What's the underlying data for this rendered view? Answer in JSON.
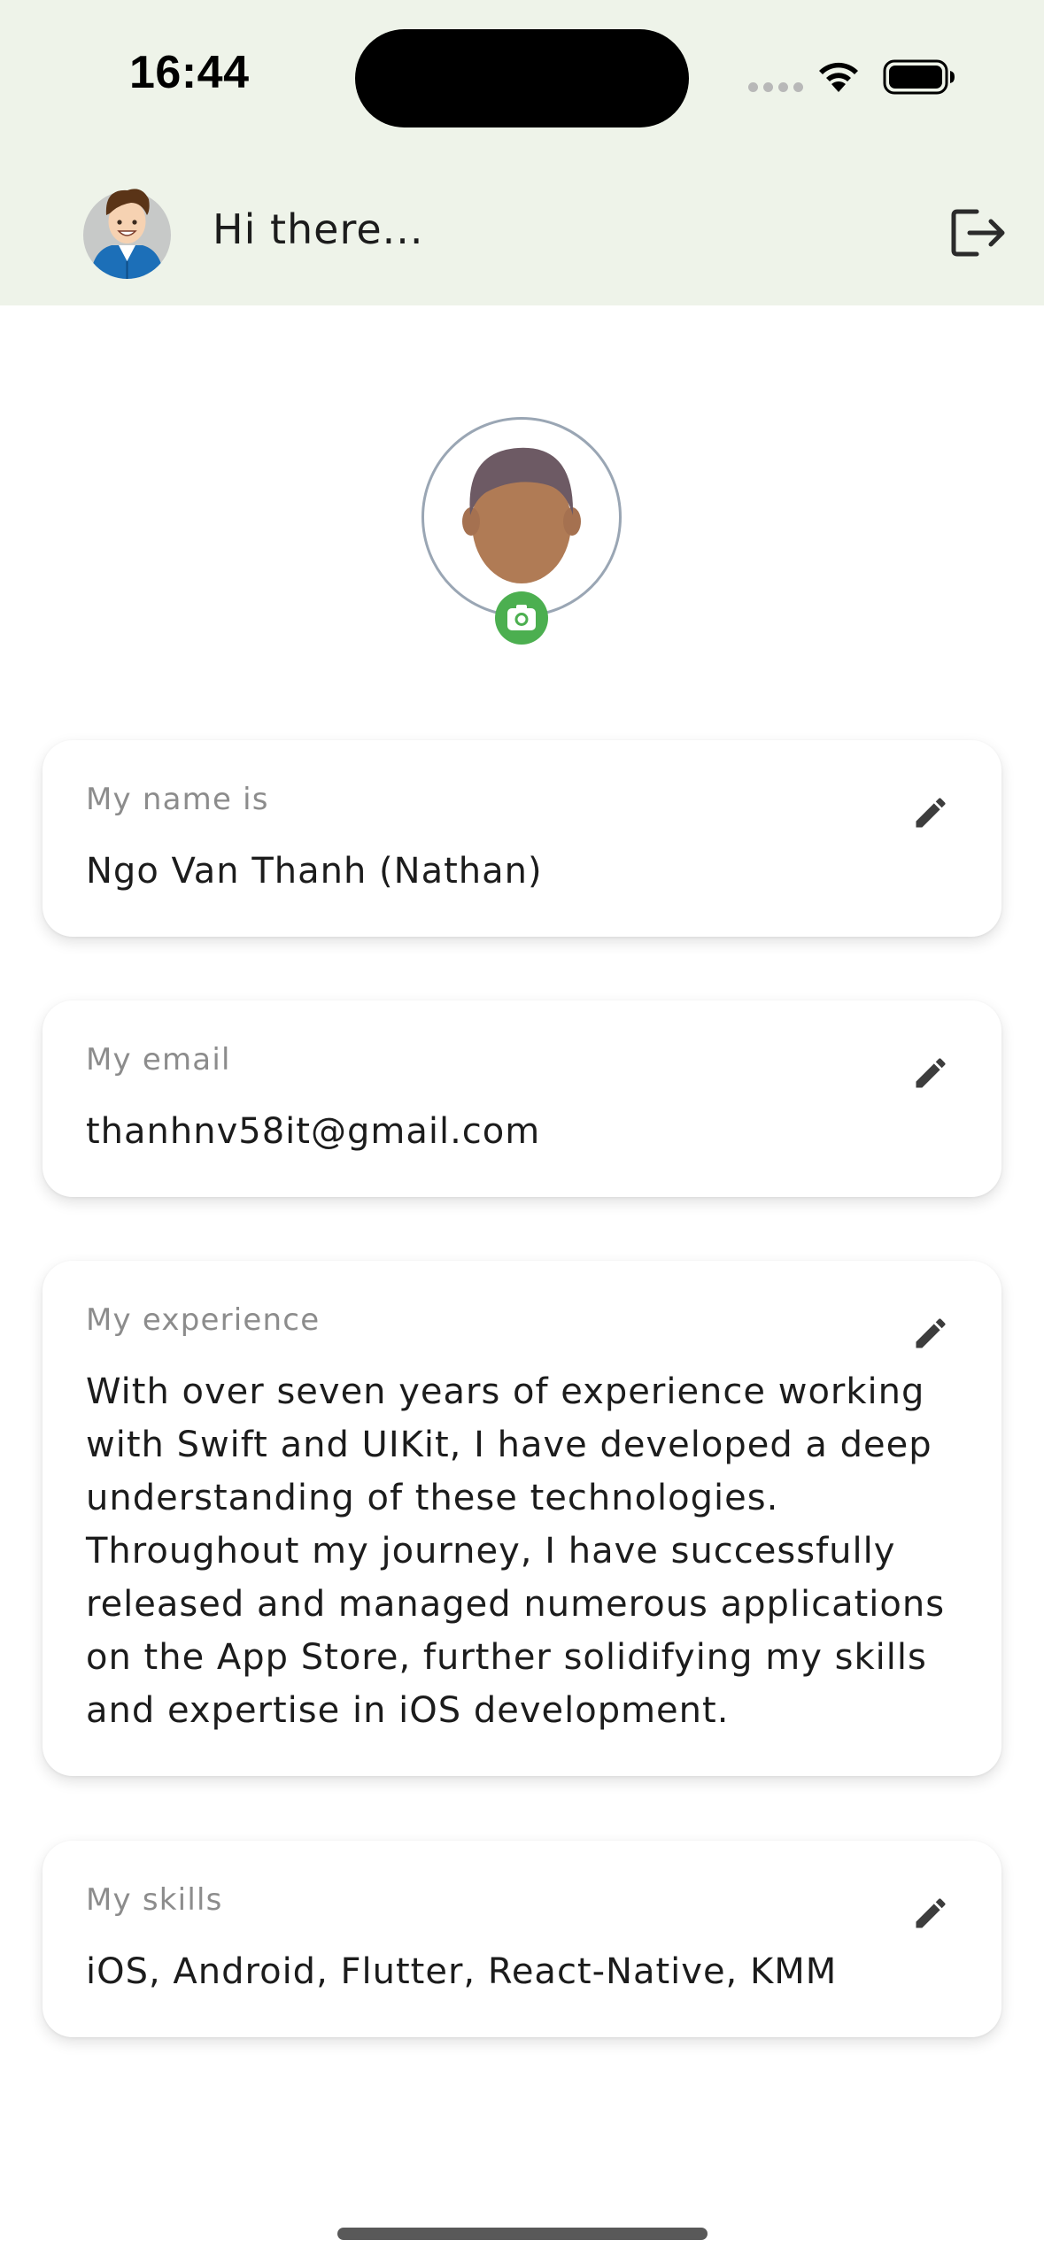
{
  "status_bar": {
    "time": "16:44",
    "wifi_icon": "wifi-icon",
    "battery_icon": "battery-icon"
  },
  "header": {
    "avatar_icon": "user-avatar",
    "greeting": "Hi there...",
    "logout_icon": "logout-icon",
    "background_color": "#eef3e9"
  },
  "profile": {
    "photo_icon": "person-placeholder",
    "camera_icon": "camera-icon",
    "camera_color": "#4caf50"
  },
  "fields": [
    {
      "label": "My name is",
      "value": "Ngo Van Thanh (Nathan)",
      "edit_icon": "pencil-icon"
    },
    {
      "label": "My email",
      "value": "thanhnv58it@gmail.com",
      "edit_icon": "pencil-icon"
    },
    {
      "label": "My experience",
      "value": "With over seven years of experience working with Swift and UIKit, I have developed a deep understanding of these technologies. Throughout my journey, I have successfully released and managed numerous applications on the App Store, further solidifying my skills and expertise in iOS development.",
      "edit_icon": "pencil-icon"
    },
    {
      "label": "My skills",
      "value": "iOS, Android, Flutter, React-Native, KMM",
      "edit_icon": "pencil-icon"
    }
  ]
}
